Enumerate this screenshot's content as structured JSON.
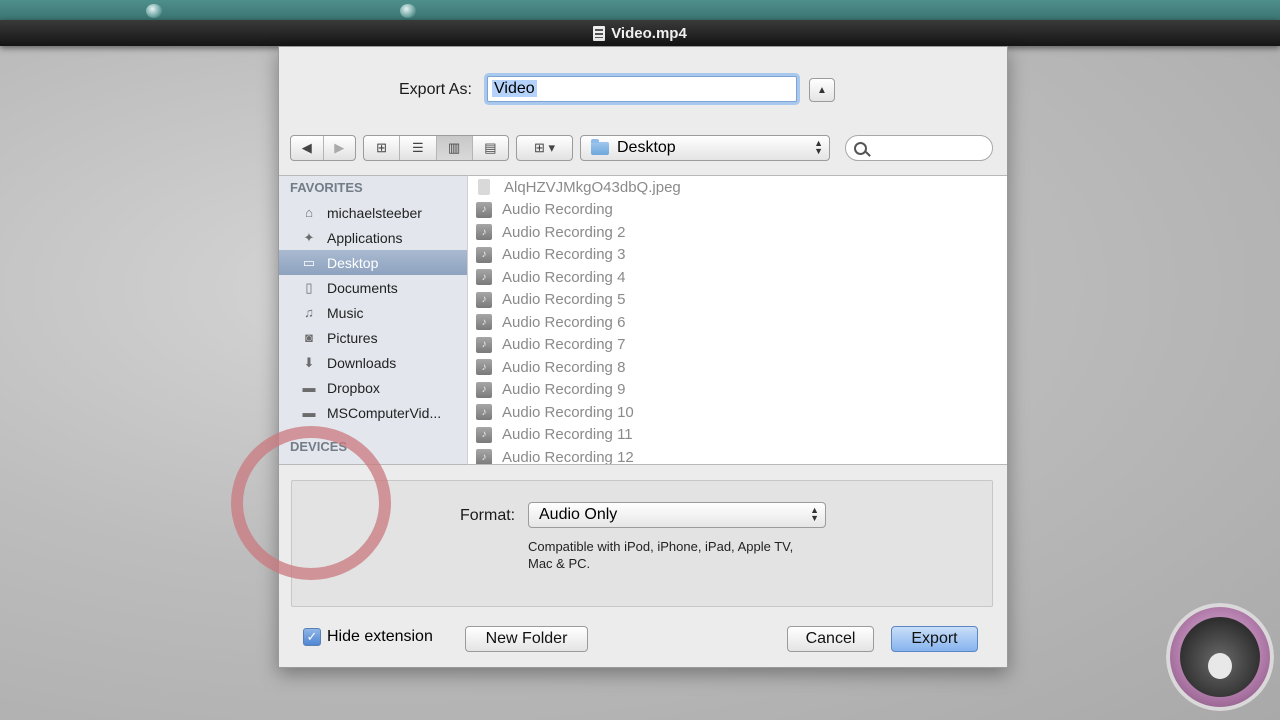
{
  "window": {
    "title": "Video.mp4"
  },
  "sheet": {
    "export_as_label": "Export As:",
    "export_as_value": "Video",
    "location": "Desktop",
    "search_placeholder": ""
  },
  "sidebar": {
    "favorites_header": "FAVORITES",
    "devices_header": "DEVICES",
    "items": [
      {
        "label": "michaelsteeber",
        "icon": "home-icon"
      },
      {
        "label": "Applications",
        "icon": "applications-icon"
      },
      {
        "label": "Desktop",
        "icon": "desktop-icon",
        "selected": true
      },
      {
        "label": "Documents",
        "icon": "documents-icon"
      },
      {
        "label": "Music",
        "icon": "music-icon"
      },
      {
        "label": "Pictures",
        "icon": "camera-icon"
      },
      {
        "label": "Downloads",
        "icon": "downloads-icon"
      },
      {
        "label": "Dropbox",
        "icon": "folder-icon"
      },
      {
        "label": "MSComputerVid...",
        "icon": "folder-icon"
      }
    ]
  },
  "files": [
    {
      "name": "AlqHZVJMkgO43dbQ.jpeg",
      "icon": "image-file-icon"
    },
    {
      "name": "Audio Recording",
      "icon": "audio-file-icon"
    },
    {
      "name": "Audio Recording 2",
      "icon": "audio-file-icon"
    },
    {
      "name": "Audio Recording 3",
      "icon": "audio-file-icon"
    },
    {
      "name": "Audio Recording 4",
      "icon": "audio-file-icon"
    },
    {
      "name": "Audio Recording 5",
      "icon": "audio-file-icon"
    },
    {
      "name": "Audio Recording 6",
      "icon": "audio-file-icon"
    },
    {
      "name": "Audio Recording 7",
      "icon": "audio-file-icon"
    },
    {
      "name": "Audio Recording 8",
      "icon": "audio-file-icon"
    },
    {
      "name": "Audio Recording 9",
      "icon": "audio-file-icon"
    },
    {
      "name": "Audio Recording 10",
      "icon": "audio-file-icon"
    },
    {
      "name": "Audio Recording 11",
      "icon": "audio-file-icon"
    },
    {
      "name": "Audio Recording 12",
      "icon": "audio-file-icon"
    }
  ],
  "format": {
    "label": "Format:",
    "value": "Audio Only",
    "description": "Compatible with iPod, iPhone, iPad, Apple TV, Mac & PC."
  },
  "bottom": {
    "hide_extension_label": "Hide extension",
    "hide_extension_checked": true,
    "new_folder_label": "New Folder",
    "cancel_label": "Cancel",
    "export_label": "Export"
  },
  "colors": {
    "accent": "#86b4ee",
    "highlight_circle": "#ca787d",
    "sidebar_selection": "#8ea3c0"
  }
}
